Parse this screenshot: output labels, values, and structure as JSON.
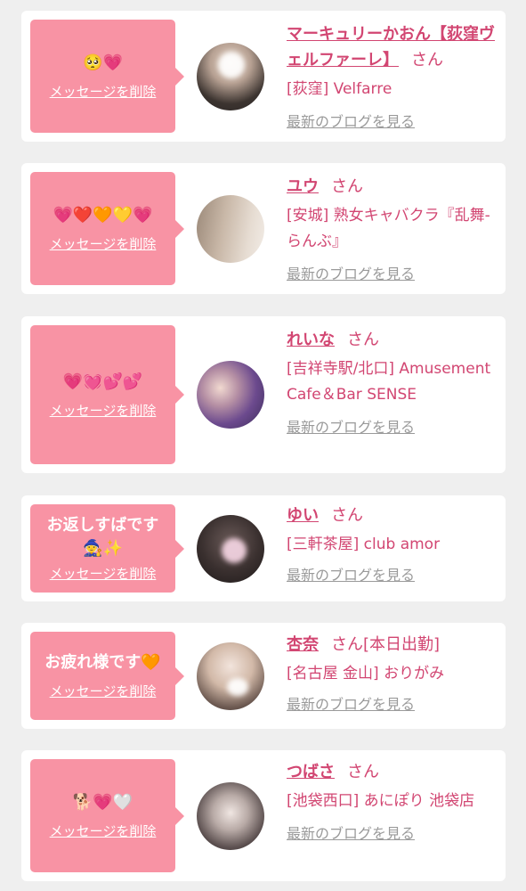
{
  "colors": {
    "page_bg": "#efefef",
    "card_bg": "#ffffff",
    "bubble_bg": "#f893a4",
    "accent_pink": "#d24672",
    "link_gray": "#9a9a9a"
  },
  "items": [
    {
      "message": "🥺💗",
      "delete_label": "メッセージを削除",
      "avatar_icon": "profile-photo",
      "name": "マーキュリーかおん【荻窪ヴェルファーレ】",
      "san": "さん",
      "status": "",
      "shop": "[荻窪] Velfarre",
      "blog_label": "最新のブログを見る"
    },
    {
      "message": "💗❤️🧡💛💗",
      "delete_label": "メッセージを削除",
      "avatar_icon": "profile-photo",
      "name": "ユウ",
      "san": "さん",
      "status": "",
      "shop": "[安城] 熟女キャバクラ『乱舞-らんぶ』",
      "blog_label": "最新のブログを見る"
    },
    {
      "message": "💗💓💕💕",
      "delete_label": "メッセージを削除",
      "avatar_icon": "profile-photo",
      "name": "れいな",
      "san": "さん",
      "status": "",
      "shop": "[吉祥寺駅/北口] Amusement Cafe＆Bar SENSE",
      "blog_label": "最新のブログを見る"
    },
    {
      "message": "お返しすばです🧙✨",
      "delete_label": "メッセージを削除",
      "avatar_icon": "profile-photo",
      "name": "ゆい",
      "san": "さん",
      "status": "",
      "shop": "[三軒茶屋] club amor",
      "blog_label": "最新のブログを見る"
    },
    {
      "message": "お疲れ様です🧡",
      "delete_label": "メッセージを削除",
      "avatar_icon": "profile-photo",
      "name": "杏奈",
      "san": "さん",
      "status": "[本日出勤]",
      "shop": "[名古屋 金山] おりがみ",
      "blog_label": "最新のブログを見る"
    },
    {
      "message": "🐕💗🤍",
      "delete_label": "メッセージを削除",
      "avatar_icon": "profile-photo",
      "name": "つばさ",
      "san": "さん",
      "status": "",
      "shop": "[池袋西口] あにぽり 池袋店",
      "blog_label": "最新のブログを見る"
    }
  ]
}
